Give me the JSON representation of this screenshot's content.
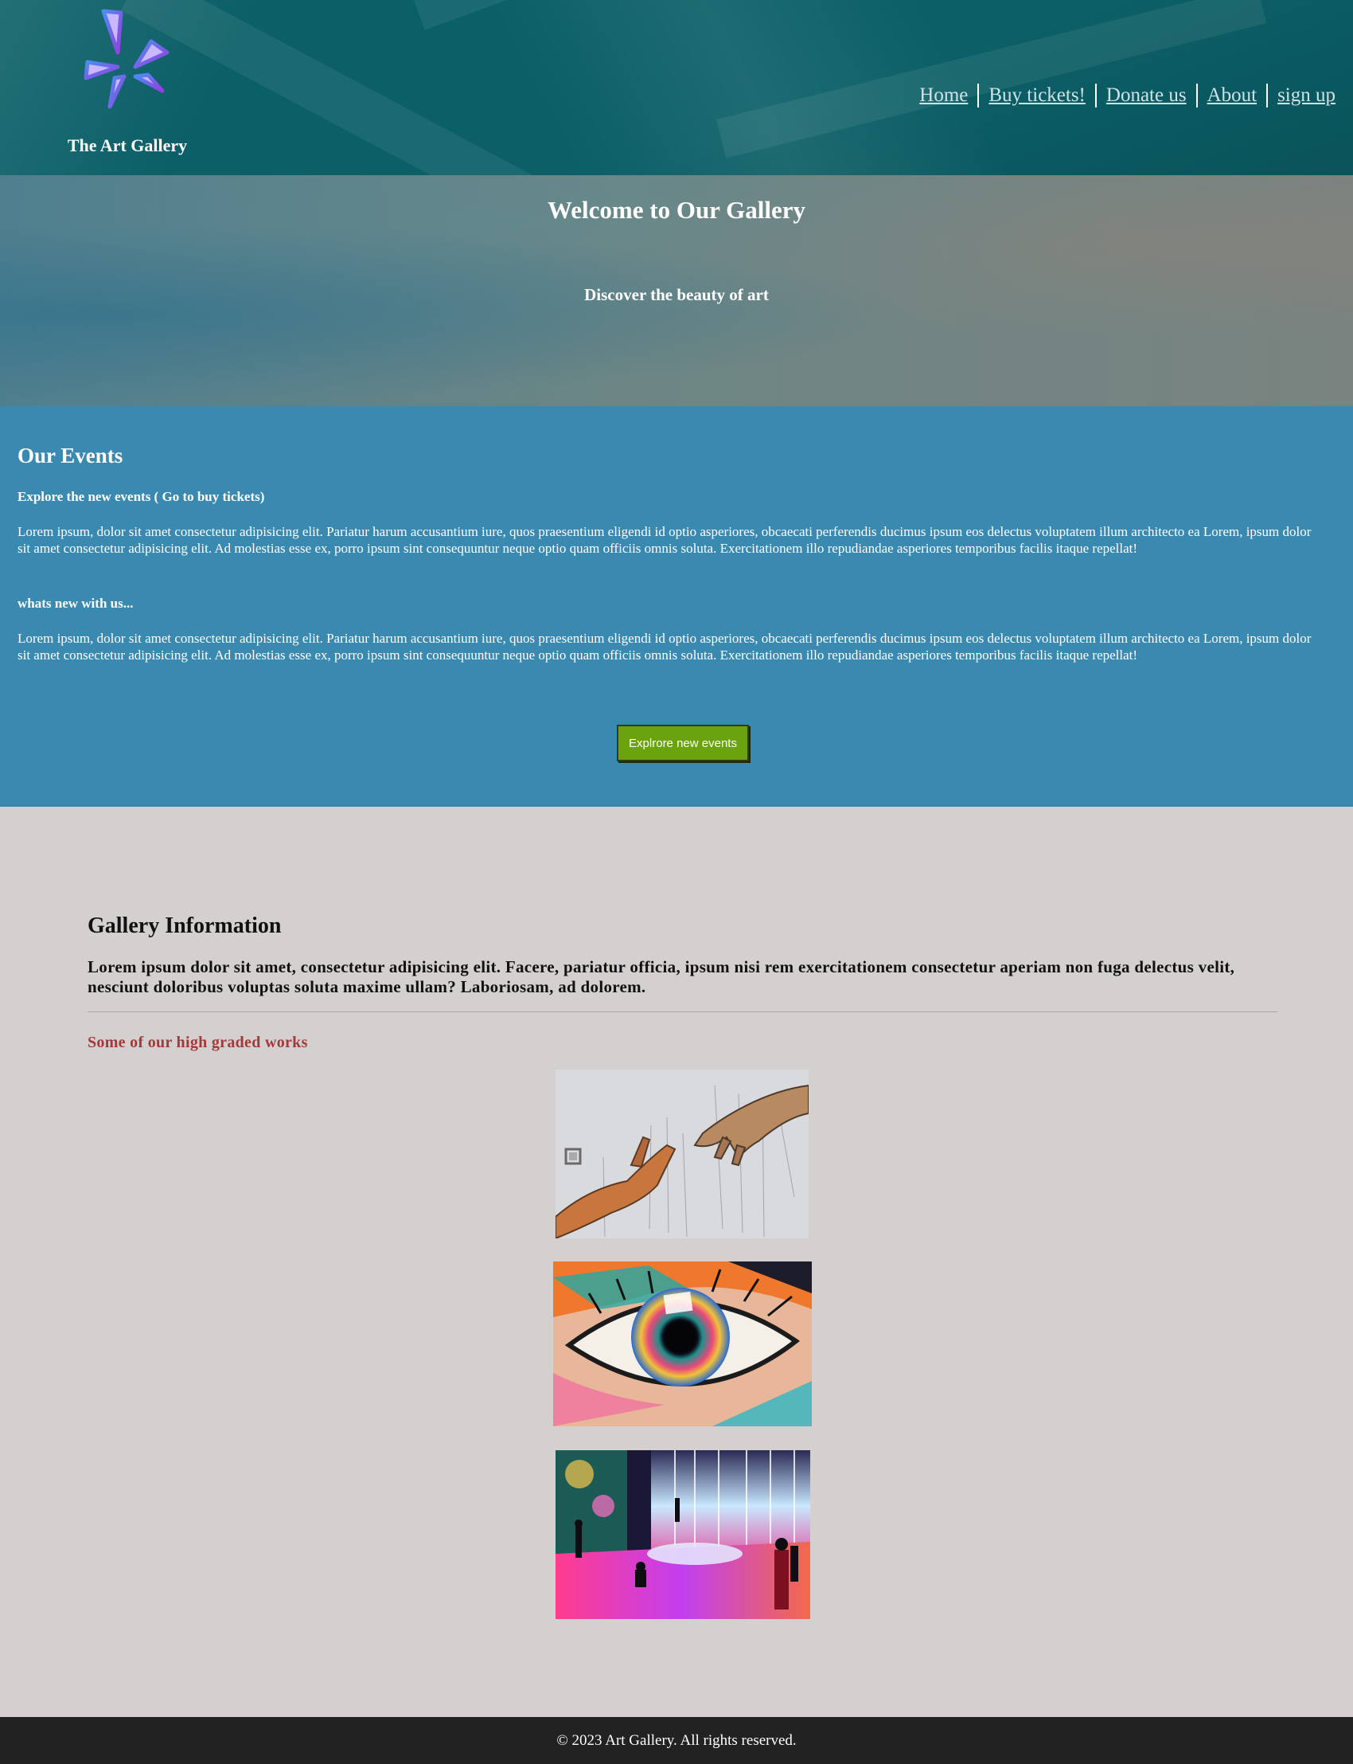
{
  "header": {
    "brand": "The Art Gallery",
    "logo_icon": "flower-logo-icon",
    "nav": [
      {
        "label": "Home"
      },
      {
        "label": "Buy tickets!"
      },
      {
        "label": "Donate us"
      },
      {
        "label": "About"
      },
      {
        "label": "sign up"
      }
    ]
  },
  "hero": {
    "title": "Welcome to Our Gallery",
    "subtitle": "Discover the beauty of art"
  },
  "events": {
    "title": "Our Events",
    "subtitle1": "Explore the new events ( Go to buy tickets)",
    "paragraph1": "Lorem ipsum, dolor sit amet consectetur adipisicing elit. Pariatur harum accusantium iure, quos praesentium eligendi id optio asperiores, obcaecati perferendis ducimus ipsum eos delectus voluptatem illum architecto ea Lorem, ipsum dolor sit amet consectetur adipisicing elit. Ad molestias esse ex, porro ipsum sint consequuntur neque optio quam officiis omnis soluta. Exercitationem illo repudiandae asperiores temporibus facilis itaque repellat!",
    "subtitle2": "whats new with us...",
    "paragraph2": "Lorem ipsum, dolor sit amet consectetur adipisicing elit. Pariatur harum accusantium iure, quos praesentium eligendi id optio asperiores, obcaecati perferendis ducimus ipsum eos delectus voluptatem illum architecto ea Lorem, ipsum dolor sit amet consectetur adipisicing elit. Ad molestias esse ex, porro ipsum sint consequuntur neque optio quam officiis omnis soluta. Exercitationem illo repudiandae asperiores temporibus facilis itaque repellat!",
    "button": "Explrore new events"
  },
  "gallery": {
    "title": "Gallery Information",
    "lead": "Lorem ipsum dolor sit amet, consectetur adipisicing elit. Facere, pariatur officia, ipsum nisi rem exercitationem consectetur aperiam non fuga delectus velit, nesciunt doloribus voluptas soluta maxime ullam? Laboriosam, ad dolorem.",
    "works_title": "Some of our high graded works",
    "works": [
      {
        "subject": "hands-sketch-artwork"
      },
      {
        "subject": "colorful-eye-artwork"
      },
      {
        "subject": "digital-waterfall-installation-artwork"
      }
    ]
  },
  "footer": {
    "copyright": "© 2023 Art Gallery. All rights reserved."
  },
  "colors": {
    "header_bg": "#0b5f67",
    "events_bg": "#3a89b0",
    "button_bg": "#6aa30e",
    "works_title": "#a33a3a",
    "page_bg": "#d4d0cf",
    "footer_bg": "#222222"
  }
}
